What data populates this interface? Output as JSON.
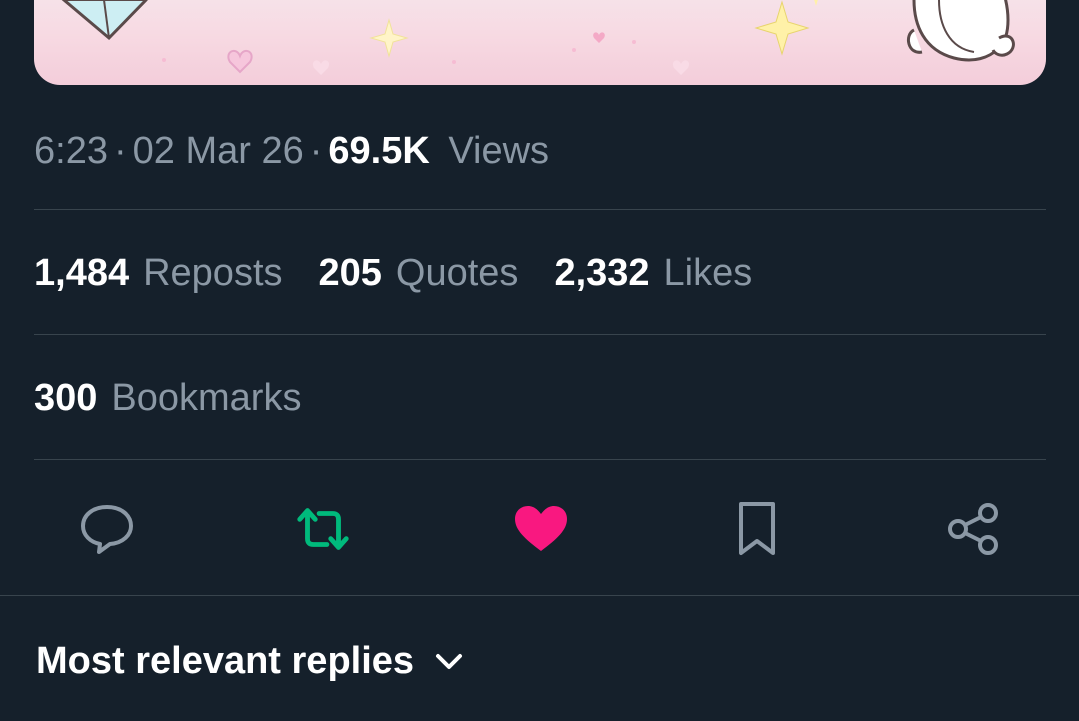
{
  "post": {
    "time": "6:23",
    "separator": "·",
    "date": "02 Mar 26",
    "views_count": "69.5K",
    "views_label": "Views"
  },
  "stats": {
    "reposts_count": "1,484",
    "reposts_label": "Reposts",
    "quotes_count": "205",
    "quotes_label": "Quotes",
    "likes_count": "2,332",
    "likes_label": "Likes",
    "bookmarks_count": "300",
    "bookmarks_label": "Bookmarks"
  },
  "actions": [
    {
      "icon": "reply-icon",
      "color": "#8b98a5"
    },
    {
      "icon": "repost-icon",
      "color": "#00ba7c",
      "active": true
    },
    {
      "icon": "heart-icon",
      "color": "#f91880",
      "active": true
    },
    {
      "icon": "bookmark-icon",
      "color": "#8b98a5"
    },
    {
      "icon": "share-icon",
      "color": "#8b98a5"
    }
  ],
  "replies": {
    "sort_label": "Most relevant replies",
    "icon": "chevron-down-icon"
  },
  "colors": {
    "background": "#15202b",
    "secondary_text": "#8b98a5",
    "divider": "#38444d",
    "repost_active": "#00ba7c",
    "like_active": "#f91880"
  }
}
